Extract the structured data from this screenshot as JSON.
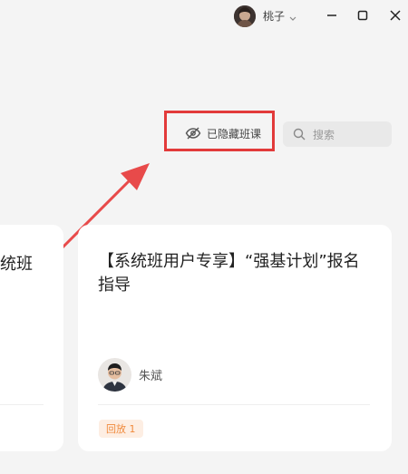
{
  "titlebar": {
    "user_name": "桃子",
    "minimize_label": "",
    "maximize_label": "",
    "close_label": ""
  },
  "toolbar": {
    "hidden_classes_label": "已隐藏班课",
    "search_placeholder": "搜索"
  },
  "cards": [
    {
      "title": "统班"
    },
    {
      "title": "【系统班用户专享】“强基计划”报名指导",
      "teacher_name": "朱斌",
      "badge_label": "回放 1"
    }
  ],
  "colors": {
    "highlight": "#e23a3a",
    "badge_text": "#f08a3c",
    "badge_bg": "#fdeee3"
  }
}
